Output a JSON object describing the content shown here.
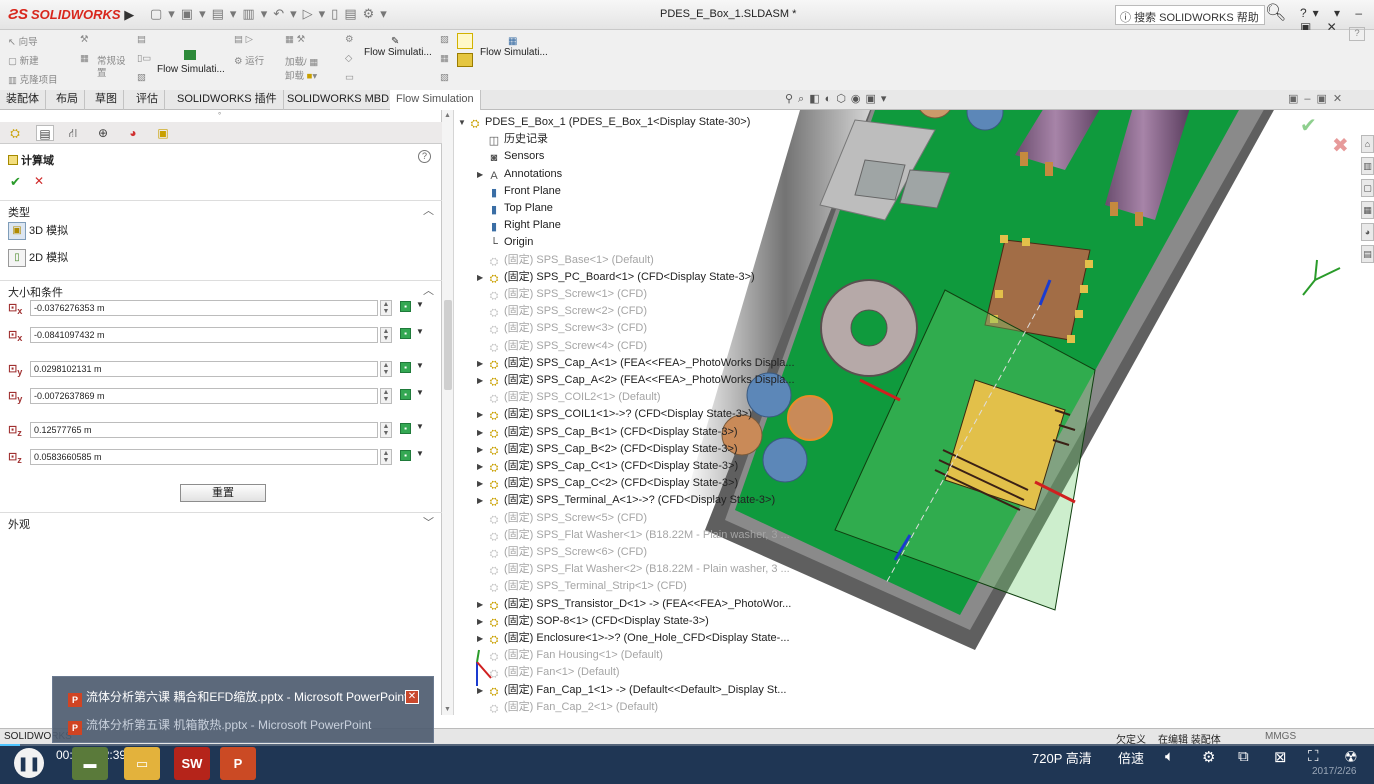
{
  "app": {
    "name": "SOLIDWORKS",
    "doc_title": "PDES_E_Box_1.SLDASM *",
    "help_search": "搜索 SOLIDWORKS 帮助"
  },
  "ribbon": {
    "col1": [
      "向导",
      "新建",
      "克隆项目"
    ],
    "col2": [
      "常规设",
      "置"
    ],
    "flow1": "Flow Simulati...",
    "col3": [
      "运行"
    ],
    "col4": [
      "加载/",
      "卸载"
    ],
    "flow2": "Flow Simulati...",
    "flow3": "Flow Simulati..."
  },
  "tabs": [
    "装配体",
    "布局",
    "草图",
    "评估",
    "SOLIDWORKS 插件",
    "SOLIDWORKS MBD",
    "Flow Simulation"
  ],
  "panel": {
    "title": "计算域",
    "type_section": "类型",
    "opt_3d": "3D 模拟",
    "opt_2d": "2D 模拟",
    "size_section": "大小和条件",
    "params": [
      {
        "axis": "x",
        "value": "-0.0376276353 m"
      },
      {
        "axis": "x",
        "value": "-0.0841097432 m"
      },
      {
        "axis": "y",
        "value": "0.0298102131 m"
      },
      {
        "axis": "y",
        "value": "-0.0072637869 m"
      },
      {
        "axis": "z",
        "value": "0.12577765 m"
      },
      {
        "axis": "z",
        "value": "0.0583660585 m"
      }
    ],
    "reset": "重置",
    "appearance_section": "外观"
  },
  "tree": [
    {
      "label": "PDES_E_Box_1  (PDES_E_Box_1<Display State-30>)",
      "arrow": "▼",
      "dim": false,
      "icon": "assembly-icon",
      "indent": 0
    },
    {
      "label": "历史记录",
      "arrow": "",
      "dim": false,
      "icon": "history-icon",
      "indent": 1
    },
    {
      "label": "Sensors",
      "arrow": "",
      "dim": false,
      "icon": "sensors-icon",
      "indent": 1
    },
    {
      "label": "Annotations",
      "arrow": "▶",
      "dim": false,
      "icon": "annotations-icon",
      "indent": 1
    },
    {
      "label": "Front Plane",
      "arrow": "",
      "dim": false,
      "icon": "plane-icon",
      "indent": 1
    },
    {
      "label": "Top Plane",
      "arrow": "",
      "dim": false,
      "icon": "plane-icon",
      "indent": 1
    },
    {
      "label": "Right Plane",
      "arrow": "",
      "dim": false,
      "icon": "plane-icon",
      "indent": 1
    },
    {
      "label": "Origin",
      "arrow": "",
      "dim": false,
      "icon": "origin-icon",
      "indent": 1
    },
    {
      "label": "(固定) SPS_Base<1> (Default)",
      "arrow": "",
      "dim": true,
      "icon": "part-icon",
      "indent": 1
    },
    {
      "label": "(固定) SPS_PC_Board<1> (CFD<Display State-3>)",
      "arrow": "▶",
      "dim": false,
      "icon": "part-icon",
      "indent": 1
    },
    {
      "label": "(固定) SPS_Screw<1> (CFD)",
      "arrow": "",
      "dim": true,
      "icon": "part-icon",
      "indent": 1
    },
    {
      "label": "(固定) SPS_Screw<2> (CFD)",
      "arrow": "",
      "dim": true,
      "icon": "part-icon",
      "indent": 1
    },
    {
      "label": "(固定) SPS_Screw<3> (CFD)",
      "arrow": "",
      "dim": true,
      "icon": "part-icon",
      "indent": 1
    },
    {
      "label": "(固定) SPS_Screw<4> (CFD)",
      "arrow": "",
      "dim": true,
      "icon": "part-icon",
      "indent": 1
    },
    {
      "label": "(固定) SPS_Cap_A<1> (FEA<<FEA>_PhotoWorks Displa...",
      "arrow": "▶",
      "dim": false,
      "icon": "part-icon",
      "indent": 1
    },
    {
      "label": "(固定) SPS_Cap_A<2> (FEA<<FEA>_PhotoWorks Displa...",
      "arrow": "▶",
      "dim": false,
      "icon": "part-icon",
      "indent": 1
    },
    {
      "label": "(固定) SPS_COIL2<1> (Default)",
      "arrow": "",
      "dim": true,
      "icon": "part-icon",
      "indent": 1
    },
    {
      "label": "(固定) SPS_COIL1<1>->? (CFD<Display State-3>)",
      "arrow": "▶",
      "dim": false,
      "icon": "part-icon",
      "indent": 1
    },
    {
      "label": "(固定) SPS_Cap_B<1> (CFD<Display State-3>)",
      "arrow": "▶",
      "dim": false,
      "icon": "part-icon",
      "indent": 1
    },
    {
      "label": "(固定) SPS_Cap_B<2> (CFD<Display State-3>)",
      "arrow": "▶",
      "dim": false,
      "icon": "part-icon",
      "indent": 1
    },
    {
      "label": "(固定) SPS_Cap_C<1> (CFD<Display State-3>)",
      "arrow": "▶",
      "dim": false,
      "icon": "part-icon",
      "indent": 1
    },
    {
      "label": "(固定) SPS_Cap_C<2> (CFD<Display State-3>)",
      "arrow": "▶",
      "dim": false,
      "icon": "part-icon",
      "indent": 1
    },
    {
      "label": "(固定) SPS_Terminal_A<1>->? (CFD<Display State-3>)",
      "arrow": "▶",
      "dim": false,
      "icon": "part-icon",
      "indent": 1
    },
    {
      "label": "(固定) SPS_Screw<5> (CFD)",
      "arrow": "",
      "dim": true,
      "icon": "part-icon",
      "indent": 1
    },
    {
      "label": "(固定) SPS_Flat Washer<1> (B18.22M - Plain washer, 3 ...",
      "arrow": "",
      "dim": true,
      "icon": "part-icon",
      "indent": 1
    },
    {
      "label": "(固定) SPS_Screw<6> (CFD)",
      "arrow": "",
      "dim": true,
      "icon": "part-icon",
      "indent": 1
    },
    {
      "label": "(固定) SPS_Flat Washer<2> (B18.22M - Plain washer, 3 ...",
      "arrow": "",
      "dim": true,
      "icon": "part-icon",
      "indent": 1
    },
    {
      "label": "(固定) SPS_Terminal_Strip<1> (CFD)",
      "arrow": "",
      "dim": true,
      "icon": "part-icon",
      "indent": 1
    },
    {
      "label": "(固定) SPS_Transistor_D<1> -> (FEA<<FEA>_PhotoWor...",
      "arrow": "▶",
      "dim": false,
      "icon": "part-icon",
      "indent": 1
    },
    {
      "label": "(固定) SOP-8<1> (CFD<Display State-3>)",
      "arrow": "▶",
      "dim": false,
      "icon": "part-icon",
      "indent": 1
    },
    {
      "label": "(固定) Enclosure<1>->? (One_Hole_CFD<Display State-...",
      "arrow": "▶",
      "dim": false,
      "icon": "part-icon",
      "indent": 1
    },
    {
      "label": "(固定) Fan Housing<1> (Default)",
      "arrow": "",
      "dim": true,
      "icon": "part-icon",
      "indent": 1
    },
    {
      "label": "(固定) Fan<1> (Default)",
      "arrow": "",
      "dim": true,
      "icon": "part-icon",
      "indent": 1
    },
    {
      "label": "(固定) Fan_Cap_1<1> -> (Default<<Default>_Display St...",
      "arrow": "▶",
      "dim": false,
      "icon": "part-icon",
      "indent": 1
    },
    {
      "label": "(固定) Fan_Cap_2<1> (Default)",
      "arrow": "",
      "dim": true,
      "icon": "part-icon",
      "indent": 1
    }
  ],
  "status": {
    "left": "SOLIDWORKS",
    "right1": "欠定义",
    "right2": "在编辑 装配体",
    "units": "MMGS"
  },
  "player": {
    "time": "00:17 / 12:39",
    "quality": "720P 高清",
    "speed": "倍速",
    "clock": "2017/2/26"
  },
  "popup": {
    "item1": "流体分析第六课 耦合和EFD缩放.pptx - Microsoft PowerPoint",
    "item2": "流体分析第五课 机箱散热.pptx - Microsoft PowerPoint"
  },
  "colors": {
    "board": "#0b9a3c",
    "enclosure": "#6e6e6e",
    "chip": "#e2c04a",
    "coil": "#7b5a7f",
    "cap": "#5c87b8"
  }
}
